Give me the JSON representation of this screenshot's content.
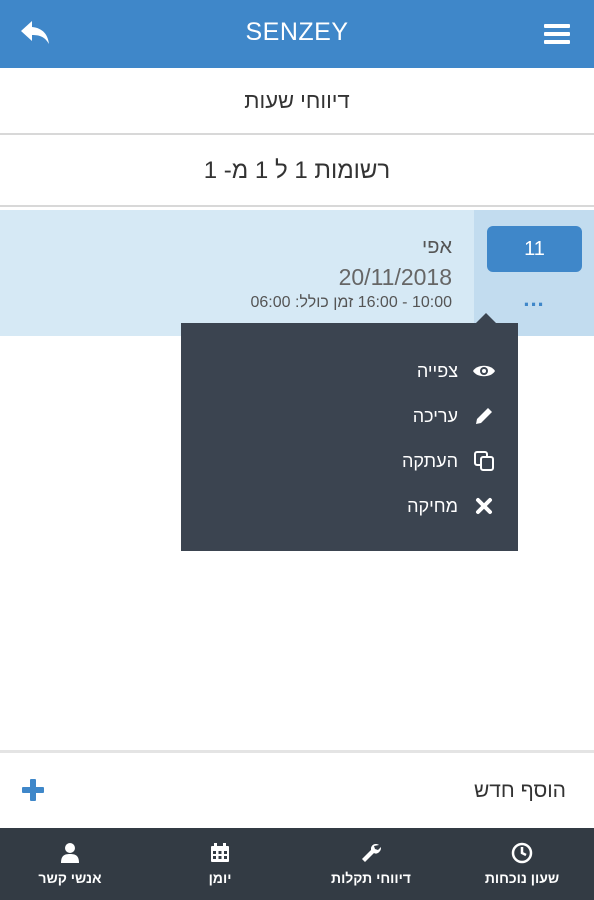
{
  "header": {
    "title": "SENZEY",
    "back_icon": "back-arrow-icon",
    "menu_icon": "hamburger-menu-icon"
  },
  "page": {
    "title": "דיווחי שעות",
    "records_summary": "רשומות 1 ל 1 מ- 1"
  },
  "record": {
    "badge": "11",
    "more": "...",
    "name": "אפי",
    "date": "20/11/2018",
    "hours": "10:00 - 16:00 זמן כולל: 06:00"
  },
  "context_menu": {
    "items": [
      {
        "label": "צפייה",
        "icon": "eye-icon"
      },
      {
        "label": "עריכה",
        "icon": "pencil-icon"
      },
      {
        "label": "העתקה",
        "icon": "copy-icon"
      },
      {
        "label": "מחיקה",
        "icon": "close-icon"
      }
    ]
  },
  "add_new": {
    "label": "הוסף חדש",
    "icon": "plus-icon"
  },
  "bottom_nav": [
    {
      "label": "שעון נוכחות",
      "icon": "clock-icon"
    },
    {
      "label": "דיווחי תקלות",
      "icon": "wrench-icon"
    },
    {
      "label": "יומן",
      "icon": "calendar-icon"
    },
    {
      "label": "אנשי קשר",
      "icon": "user-icon"
    }
  ],
  "colors": {
    "primary": "#3f87c9",
    "row_bg": "#d6e9f5",
    "dark": "#333b44",
    "popup": "#3b4450"
  }
}
